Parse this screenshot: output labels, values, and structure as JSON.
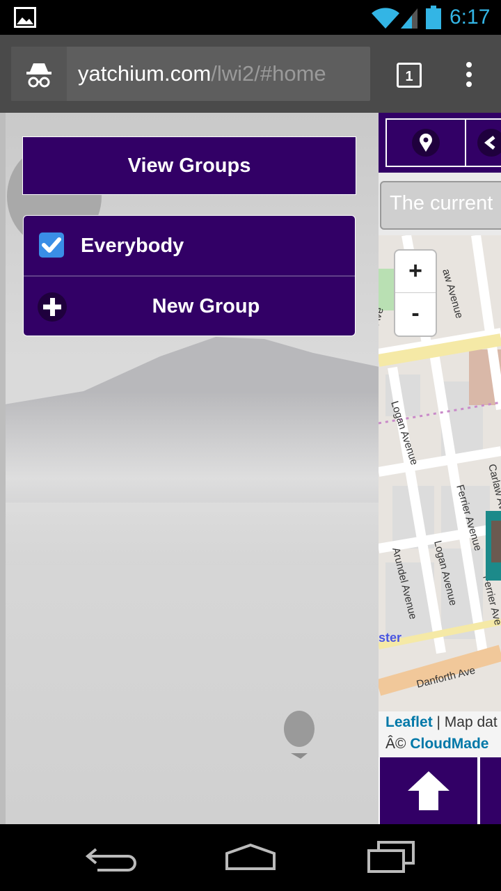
{
  "status_bar": {
    "time": "6:17",
    "icons": [
      "image-notification-icon",
      "wifi-icon",
      "signal-icon",
      "battery-icon"
    ]
  },
  "browser": {
    "url_host": "yatchium.com",
    "url_path": "/lwi2/#home",
    "tab_count": "1",
    "icons": [
      "incognito-icon",
      "tabs-icon",
      "overflow-menu-icon"
    ]
  },
  "sidebar": {
    "view_groups_label": "View Groups",
    "groups": [
      {
        "label": "Everybody",
        "checked": true
      }
    ],
    "new_group_label": "New Group"
  },
  "map_panel": {
    "current_text": "The current",
    "zoom_in": "+",
    "zoom_out": "-",
    "attribution": {
      "leaflet": "Leaflet",
      "separator": " | Map dat",
      "copyright": "Â© ",
      "cloudmade": "CloudMade"
    },
    "street_labels": [
      "Logan Avenue",
      "Ferrier Avenue",
      "Arundel Avenue",
      "Logan Avenue",
      "Ferrier Ave",
      "Carlaw Av",
      "Danforth Ave",
      "ster",
      "aw Avenue",
      "Ave"
    ]
  },
  "colors": {
    "primary_purple": "#320066",
    "status_blue": "#33b5e5",
    "checkbox_blue": "#3a8ee6",
    "link_blue": "#0078a8"
  }
}
